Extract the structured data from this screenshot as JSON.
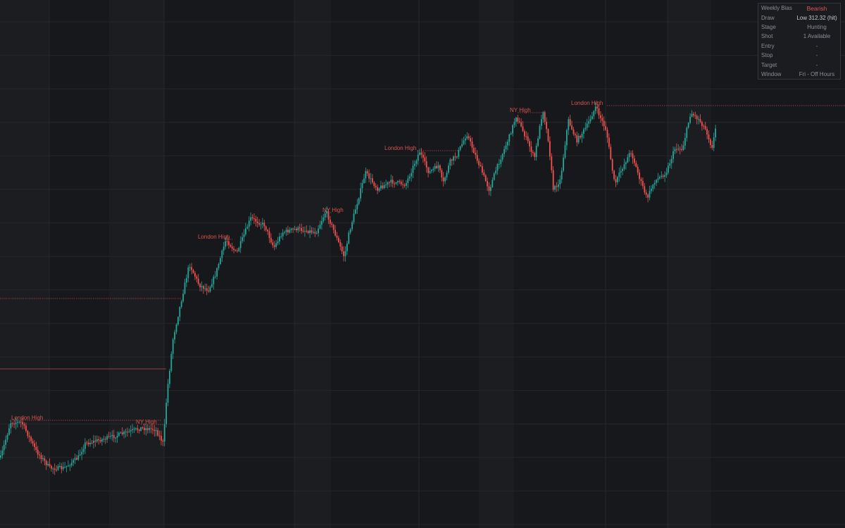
{
  "colors": {
    "background": "#17181b",
    "grid": "#24262a",
    "up": "#26a69a",
    "down": "#ef5350",
    "level": "#d9534f"
  },
  "panel": {
    "rows": [
      {
        "label": "Weekly Bias",
        "value": "Bearish",
        "tone": "bear"
      },
      {
        "label": "Draw",
        "value": "Low 312.32 (hit)",
        "tone": "strong"
      },
      {
        "label": "Stage",
        "value": "Hunting",
        "tone": "normal"
      },
      {
        "label": "Shot",
        "value": "1 Available",
        "tone": "normal"
      },
      {
        "label": "Entry",
        "value": "-",
        "tone": "normal"
      },
      {
        "label": "Stop",
        "value": "-",
        "tone": "normal"
      },
      {
        "label": "Target",
        "value": "-",
        "tone": "normal"
      },
      {
        "label": "Window",
        "value": "Fri - Off Hours",
        "tone": "normal"
      }
    ]
  },
  "chart_data": {
    "type": "candlestick",
    "ylim": [
      0,
      750
    ],
    "grid": true,
    "session_bands": [
      [
        0,
        70
      ],
      [
        155,
        233
      ],
      [
        418,
        470
      ],
      [
        680,
        730
      ],
      [
        948,
        1010
      ]
    ],
    "session_dividers": [
      70,
      233,
      418,
      595,
      860,
      948
    ],
    "waypoints": [
      [
        0,
        650
      ],
      [
        14,
        600
      ],
      [
        30,
        600
      ],
      [
        50,
        640
      ],
      [
        70,
        665
      ],
      [
        90,
        665
      ],
      [
        110,
        650
      ],
      [
        120,
        630
      ],
      [
        160,
        620
      ],
      [
        200,
        608
      ],
      [
        220,
        610
      ],
      [
        231,
        630
      ],
      [
        236,
        560
      ],
      [
        245,
        480
      ],
      [
        258,
        420
      ],
      [
        268,
        375
      ],
      [
        282,
        405
      ],
      [
        295,
        412
      ],
      [
        305,
        390
      ],
      [
        320,
        340
      ],
      [
        335,
        360
      ],
      [
        355,
        310
      ],
      [
        375,
        320
      ],
      [
        388,
        352
      ],
      [
        400,
        330
      ],
      [
        420,
        325
      ],
      [
        448,
        330
      ],
      [
        462,
        300
      ],
      [
        478,
        340
      ],
      [
        488,
        365
      ],
      [
        495,
        330
      ],
      [
        518,
        245
      ],
      [
        535,
        268
      ],
      [
        555,
        258
      ],
      [
        575,
        262
      ],
      [
        595,
        215
      ],
      [
        608,
        245
      ],
      [
        622,
        235
      ],
      [
        628,
        262
      ],
      [
        638,
        230
      ],
      [
        648,
        220
      ],
      [
        662,
        190
      ],
      [
        676,
        225
      ],
      [
        694,
        270
      ],
      [
        702,
        245
      ],
      [
        722,
        195
      ],
      [
        732,
        165
      ],
      [
        748,
        200
      ],
      [
        758,
        225
      ],
      [
        770,
        155
      ],
      [
        778,
        200
      ],
      [
        785,
        270
      ],
      [
        795,
        255
      ],
      [
        806,
        170
      ],
      [
        818,
        200
      ],
      [
        832,
        180
      ],
      [
        845,
        152
      ],
      [
        860,
        185
      ],
      [
        872,
        262
      ],
      [
        882,
        240
      ],
      [
        895,
        215
      ],
      [
        908,
        255
      ],
      [
        918,
        282
      ],
      [
        928,
        258
      ],
      [
        945,
        245
      ],
      [
        958,
        210
      ],
      [
        968,
        212
      ],
      [
        980,
        160
      ],
      [
        992,
        170
      ],
      [
        1002,
        185
      ],
      [
        1010,
        210
      ],
      [
        1017,
        175
      ]
    ],
    "levels": [
      {
        "name": "London High",
        "y": 597,
        "x_start": 14,
        "x_end": 230,
        "label_x": 16,
        "style": "dotted"
      },
      {
        "name": "NY High",
        "y": 603,
        "x_start": 200,
        "x_end": 233,
        "label_x": 193,
        "style": "dotted"
      },
      {
        "name": "",
        "y": 424,
        "x_start": 0,
        "x_end": 258,
        "style": "dotted"
      },
      {
        "name": "",
        "y": 524,
        "x_start": 0,
        "x_end": 236,
        "style": "solid"
      },
      {
        "name": "London High",
        "y": 340,
        "x_start": 320,
        "x_end": 330,
        "label_x": 281,
        "style": "dotted"
      },
      {
        "name": "NY High",
        "y": 302,
        "x_start": 460,
        "x_end": 472,
        "label_x": 458,
        "style": "dotted"
      },
      {
        "name": "London High",
        "y": 214,
        "x_start": 592,
        "x_end": 650,
        "label_x": 546,
        "style": "dotted"
      },
      {
        "name": "NY High",
        "y": 160,
        "x_start": 735,
        "x_end": 770,
        "label_x": 724,
        "style": "dotted"
      },
      {
        "name": "London High",
        "y": 150,
        "x_start": 862,
        "x_end": 1200,
        "label_x": 811,
        "style": "dotted"
      }
    ]
  }
}
